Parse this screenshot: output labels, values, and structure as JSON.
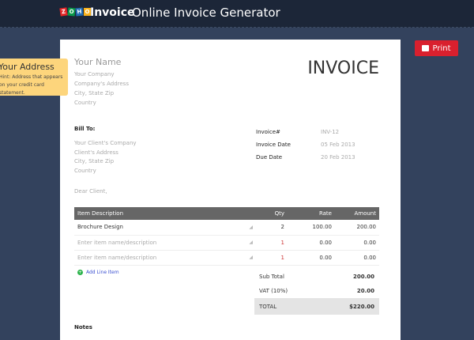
{
  "header": {
    "logo_letters": [
      "Z",
      "O",
      "H",
      "O"
    ],
    "brand": "Invoice",
    "title": "Online Invoice Generator"
  },
  "print_label": "Print",
  "tooltip": {
    "title": "Your Address",
    "hint": "Hint: Address that appears on your credit card statement."
  },
  "from": {
    "name": "Your Name",
    "company": "Your Company",
    "address": "Company's Address",
    "city": "City, State Zip",
    "country": "Country"
  },
  "invoice_title": "INVOICE",
  "bill_to": {
    "label": "Bill To:",
    "company": "Your Client's Company",
    "address": "Client's Address",
    "city": "City, State Zip",
    "country": "Country"
  },
  "meta": [
    {
      "label": "Invoice#",
      "value": "INV-12"
    },
    {
      "label": "Invoice Date",
      "value": "05 Feb 2013"
    },
    {
      "label": "Due Date",
      "value": "20 Feb 2013"
    }
  ],
  "greeting": "Dear Client,",
  "table": {
    "headers": [
      "Item Description",
      "Qty",
      "Rate",
      "Amount"
    ],
    "rows": [
      {
        "desc": "Brochure Design",
        "qty": "2",
        "rate": "100.00",
        "amount": "200.00"
      },
      {
        "desc": "",
        "placeholder": "Enter item name/description",
        "qty": "1",
        "rate": "0.00",
        "amount": "0.00"
      },
      {
        "desc": "",
        "placeholder": "Enter item name/description",
        "qty": "1",
        "rate": "0.00",
        "amount": "0.00"
      }
    ]
  },
  "add_line": "Add Line Item",
  "totals": {
    "sub_label": "Sub Total",
    "sub": "200.00",
    "vat_label": "VAT (10%)",
    "vat": "20.00",
    "total_label": "TOTAL",
    "total": "$220.00"
  },
  "notes_label": "Notes"
}
